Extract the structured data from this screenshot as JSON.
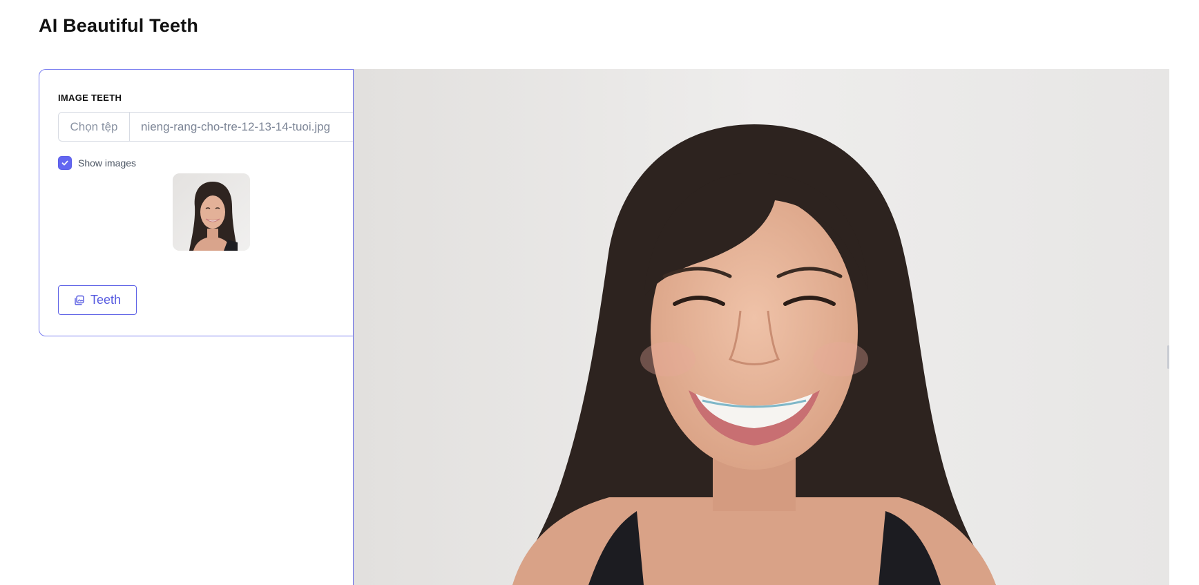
{
  "app": {
    "title": "AI Beautiful Teeth"
  },
  "form": {
    "field_label": "IMAGE TEETH",
    "file_button_label": "Chọn tệp",
    "file_name": "nieng-rang-cho-tre-12-13-14-tuoi.jpg",
    "show_images_label": "Show images",
    "show_images_checked": true,
    "submit_label": "Teeth",
    "submit_icon": "images-icon"
  },
  "colors": {
    "accent": "#6366f1",
    "border": "#7b7ff0",
    "muted_text": "#7c8596"
  }
}
